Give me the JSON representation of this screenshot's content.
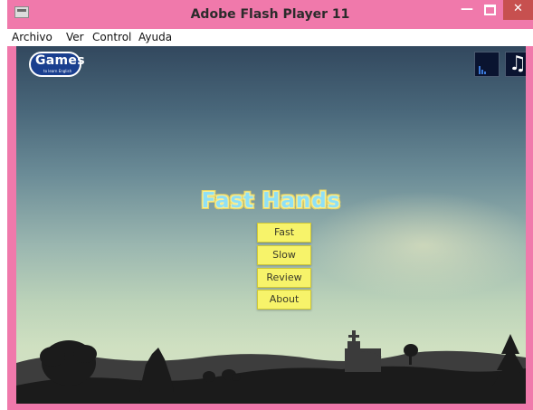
{
  "window": {
    "title": "Adobe Flash Player 11",
    "min_glyph": "—",
    "close_glyph": "✕"
  },
  "menubar": {
    "items": [
      "Archivo",
      "Ver",
      "Control",
      "Ayuda"
    ]
  },
  "game": {
    "logo_word": "Games",
    "logo_sub": "to learn English",
    "title": "Fast Hands",
    "music_glyph": "♫",
    "menu": [
      "Fast",
      "Slow",
      "Review",
      "About"
    ]
  },
  "colors": {
    "window_frame": "#f079ab",
    "close_button": "#c7504f",
    "button_fill": "#f7f36a",
    "title_text": "#8fe0f6",
    "silhouette": "#1b1b1b"
  },
  "icons": [
    "app-icon",
    "minimize-icon",
    "maximize-icon",
    "close-icon",
    "quality-icon",
    "music-note-icon"
  ]
}
